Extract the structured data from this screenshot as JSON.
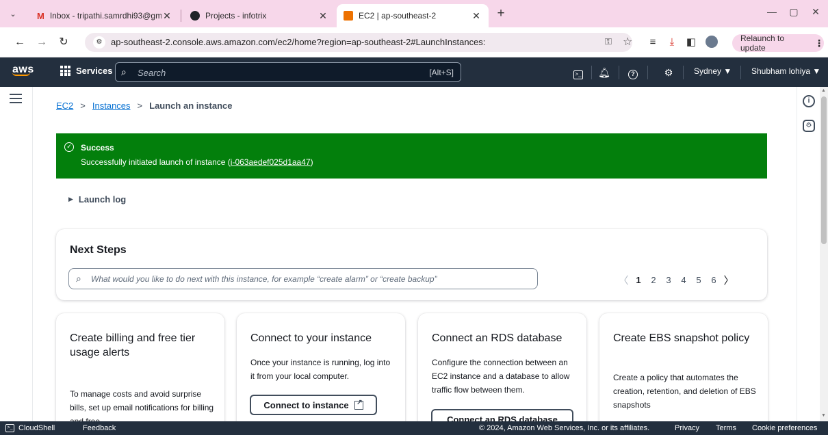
{
  "browser": {
    "tabs": [
      {
        "title": "Inbox - tripathi.samrdhi93@gm",
        "favicon": "gmail-icon"
      },
      {
        "title": "Projects - infotrix",
        "favicon": "github-icon"
      },
      {
        "title": "EC2 | ap-southeast-2",
        "favicon": "aws-icon",
        "active": true
      }
    ],
    "url": "ap-southeast-2.console.aws.amazon.com/ec2/home?region=ap-southeast-2#LaunchInstances:",
    "relaunch_label": "Relaunch to update"
  },
  "aws_nav": {
    "logo": "aws",
    "services_label": "Services",
    "search_placeholder": "Search",
    "search_shortcut": "[Alt+S]",
    "region": "Sydney ▼",
    "user": "Shubham lohiya ▼"
  },
  "breadcrumb": {
    "items": [
      "EC2",
      "Instances"
    ],
    "current": "Launch an instance"
  },
  "flash": {
    "title": "Success",
    "message_prefix": "Successfully initiated launch of instance (",
    "instance_id": "i-063aedef025d1aa47",
    "message_suffix": ")"
  },
  "launch_log_label": "Launch log",
  "next_steps": {
    "title": "Next Steps",
    "search_placeholder": "What would you like to do next with this instance, for example “create alarm” or “create backup”",
    "pages": [
      "1",
      "2",
      "3",
      "4",
      "5",
      "6"
    ],
    "current_page": "1"
  },
  "cards": [
    {
      "title": "Create billing and free tier usage alerts",
      "description": "To manage costs and avoid surprise bills, set up email notifications for billing and free"
    },
    {
      "title": "Connect to your instance",
      "description": "Once your instance is running, log into it from your local computer.",
      "button": "Connect to instance"
    },
    {
      "title": "Connect an RDS database",
      "description": "Configure the connection between an EC2 instance and a database to allow traffic flow between them.",
      "button": "Connect an RDS database"
    },
    {
      "title": "Create EBS snapshot policy",
      "description": "Create a policy that automates the creation, retention, and deletion of EBS snapshots"
    }
  ],
  "footer": {
    "cloudshell": "CloudShell",
    "feedback": "Feedback",
    "copyright": "© 2024, Amazon Web Services, Inc. or its affiliates.",
    "privacy": "Privacy",
    "terms": "Terms",
    "cookies": "Cookie preferences"
  }
}
